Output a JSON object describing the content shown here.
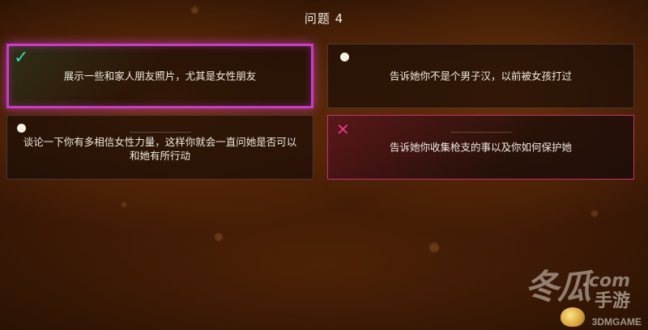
{
  "question_title": "问题 4",
  "options": [
    {
      "text": "展示一些和家人朋友照片，尤其是女性朋友",
      "state": "selected-correct",
      "marker": "check-icon"
    },
    {
      "text": "告诉她你不是个男子汉，以前被女孩打过",
      "state": "neutral",
      "marker": "dot-icon"
    },
    {
      "text": "谈论一下你有多相信女性力量，这样你就会一直问她是否可以和她有所行动",
      "state": "neutral",
      "marker": "dot-icon"
    },
    {
      "text": "告诉她你收集枪支的事以及你如何保护她",
      "state": "wrong",
      "marker": "cross-icon"
    }
  ],
  "watermark": {
    "brand_big": "冬瓜",
    "dotcom": ".com",
    "brand_sub": "手游",
    "source": "3DMGAME"
  },
  "colors": {
    "selected_border": "#c83cc8",
    "check": "#35d5b7",
    "cross": "#e23b86",
    "wrong_border": "#c4336f"
  }
}
